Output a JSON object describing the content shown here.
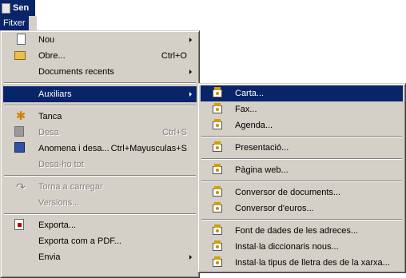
{
  "titlebar": {
    "title": "Sen"
  },
  "menubar": {
    "active_menu": "Fitxer"
  },
  "file_menu": {
    "items": [
      {
        "label": "Nou",
        "icon": "new-document-icon",
        "submenu": true
      },
      {
        "label": "Obre...",
        "shortcut": "Ctrl+O",
        "icon": "open-folder-icon"
      },
      {
        "label": "Documents recents",
        "submenu": true
      },
      {
        "label": "Auxiliars",
        "submenu": true,
        "selected": true
      },
      {
        "label": "Tanca",
        "icon": "close-document-icon"
      },
      {
        "label": "Desa",
        "shortcut": "Ctrl+S",
        "icon": "save-icon",
        "disabled": true
      },
      {
        "label": "Anomena i desa...",
        "shortcut": "Ctrl+Mayusculas+S",
        "icon": "save-as-icon"
      },
      {
        "label": "Desa-ho tot",
        "disabled": true
      },
      {
        "label": "Torna a carregar",
        "icon": "reload-icon",
        "disabled": true
      },
      {
        "label": "Versions...",
        "disabled": true
      },
      {
        "label": "Exporta...",
        "icon": "export-icon"
      },
      {
        "label": "Exporta com a PDF..."
      },
      {
        "label": "Envia",
        "submenu": true
      }
    ]
  },
  "wizards_menu": {
    "items": [
      {
        "label": "Carta...",
        "selected": true
      },
      {
        "label": "Fax..."
      },
      {
        "label": "Agenda..."
      },
      {
        "label": "Presentació..."
      },
      {
        "label": "Pàgina web..."
      },
      {
        "label": "Conversor de documents..."
      },
      {
        "label": "Conversor d'euros..."
      },
      {
        "label": "Font de dades de les adreces..."
      },
      {
        "label": "Instal·la diccionaris nous..."
      },
      {
        "label": "Instal·la tipus de lletra des de la xarxa..."
      }
    ]
  },
  "colors": {
    "menu_background": "#d4d0c8",
    "selection": "#0a246a",
    "disabled_text": "#808080"
  }
}
